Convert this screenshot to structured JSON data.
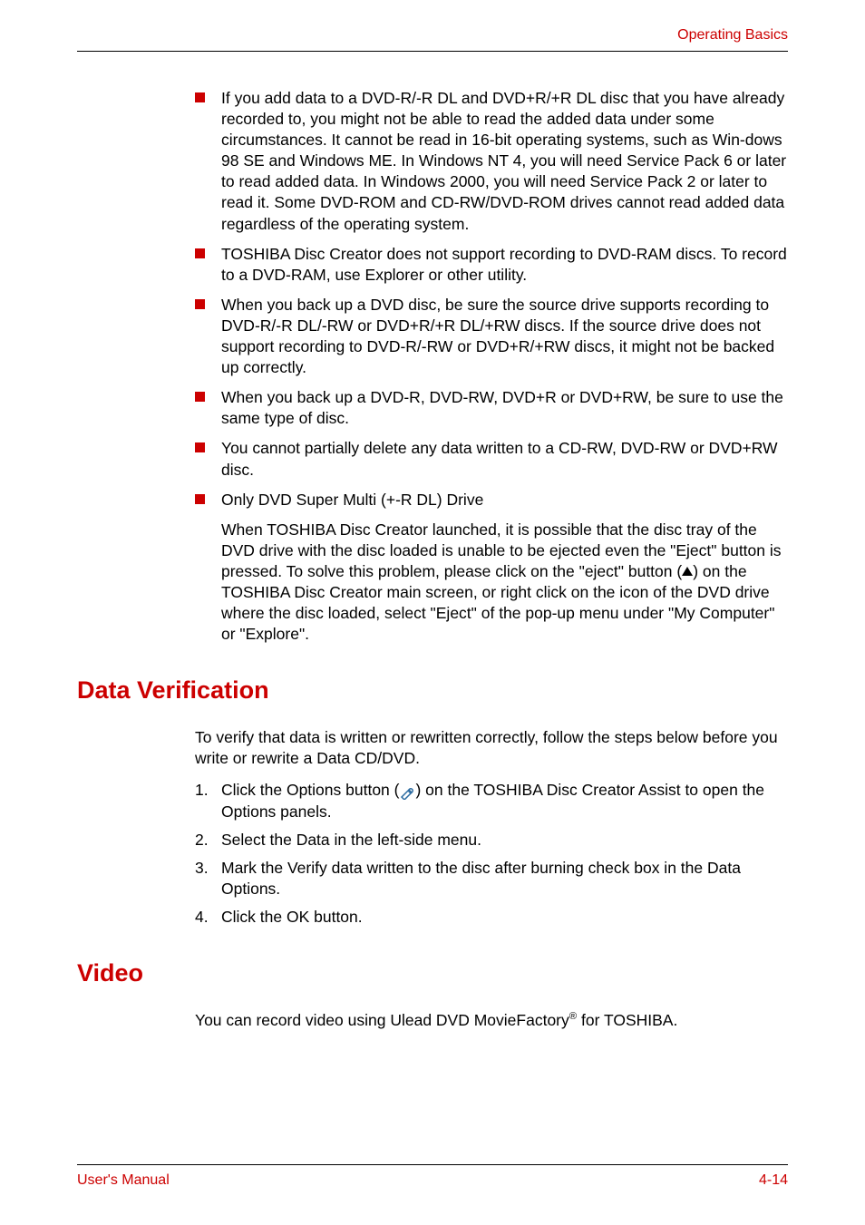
{
  "header": {
    "section_label": "Operating Basics"
  },
  "bullets": [
    "If you add data to a DVD-R/-R DL and DVD+R/+R DL disc that you have already recorded to, you might not be able to read the added data under some circumstances. It cannot be read in 16-bit operating systems, such as Win-dows 98 SE and Windows ME. In Windows NT 4, you will need Service Pack 6 or later to read added data. In Windows 2000, you will need Service Pack 2 or later to read it. Some DVD-ROM and CD-RW/DVD-ROM drives cannot read added data regardless of the operating system.",
    "TOSHIBA Disc Creator does not support recording to DVD-RAM discs. To record to a DVD-RAM, use Explorer or other utility.",
    "When you back up a DVD disc, be sure the source drive supports recording to DVD-R/-R DL/-RW or DVD+R/+R DL/+RW discs. If the source drive does not support recording to DVD-R/-RW or DVD+R/+RW discs, it might not be backed up correctly.",
    "When you back up a DVD-R, DVD-RW, DVD+R or DVD+RW, be sure to use the same type of disc.",
    "You cannot partially delete any data written to a CD-RW, DVD-RW or DVD+RW disc.",
    "Only DVD Super Multi (+-R DL) Drive"
  ],
  "bullet6_continuation_pre": "When TOSHIBA Disc Creator launched, it is possible that the disc tray of the DVD drive with the disc loaded is unable to be ejected even the \"Eject\" button is pressed. To solve this problem, please click on the \"eject\" button (",
  "bullet6_continuation_post": ") on the TOSHIBA Disc Creator main screen, or right click on the icon of the DVD drive where the disc loaded, select \"Eject\" of the pop-up menu under \"My Computer\" or \"Explore\".",
  "sections": {
    "data_verification": {
      "heading": "Data Verification",
      "intro": "To verify that data is written or rewritten correctly, follow the steps below before you write or rewrite a Data CD/DVD.",
      "steps": {
        "s1_pre": "Click the Options button (",
        "s1_post": ") on the TOSHIBA Disc Creator Assist to open the Options panels.",
        "s2": "Select the Data in the left-side menu.",
        "s3": "Mark the Verify data written to the disc after burning check box in the Data Options.",
        "s4": "Click the OK button."
      },
      "markers": {
        "n1": "1.",
        "n2": "2.",
        "n3": "3.",
        "n4": "4."
      }
    },
    "video": {
      "heading": "Video",
      "body_pre": "You can record video using Ulead DVD MovieFactory",
      "body_post": " for TOSHIBA.",
      "reg": "®"
    }
  },
  "footer": {
    "left": "User's Manual",
    "right": "4-14"
  }
}
